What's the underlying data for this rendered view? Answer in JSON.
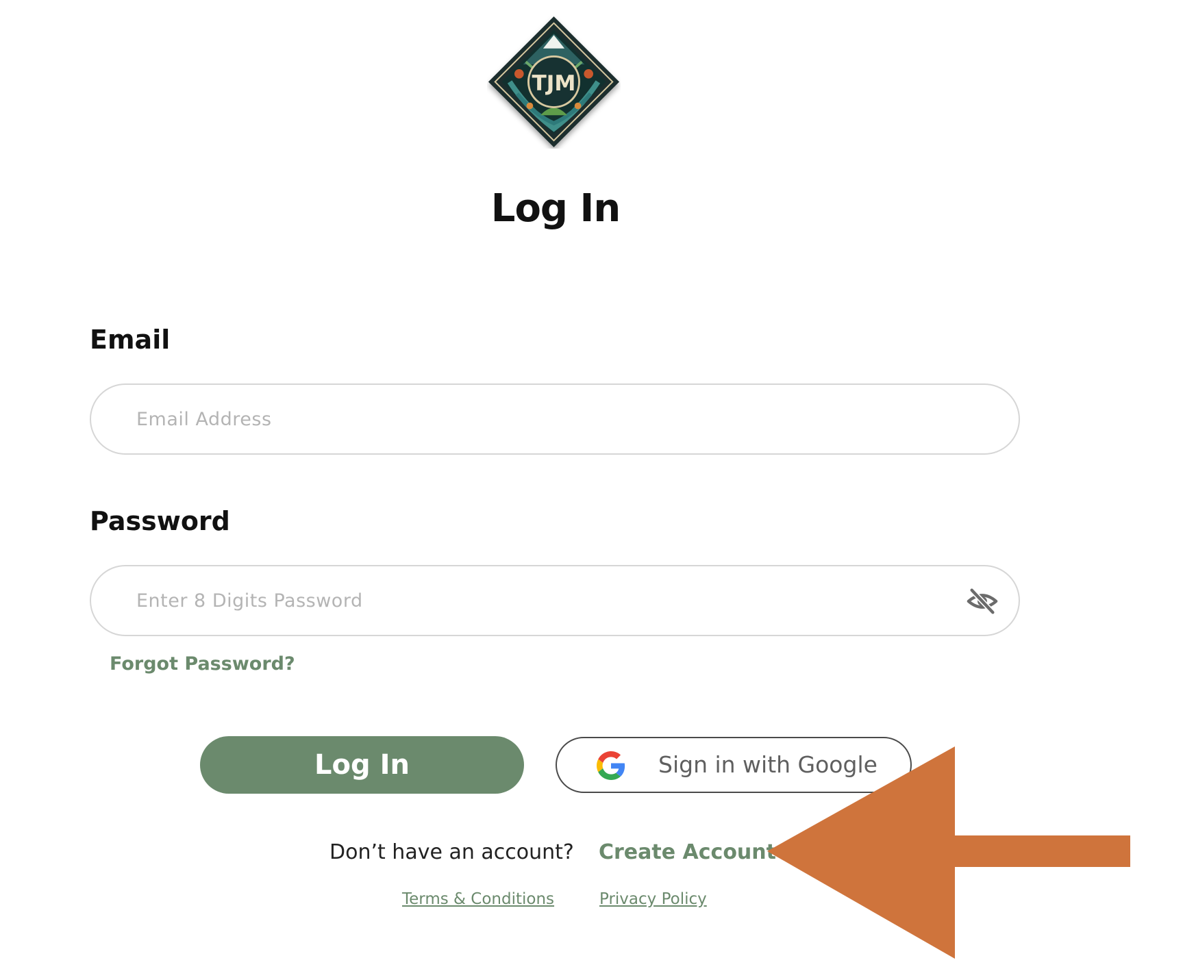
{
  "logo": {
    "text": "TJM",
    "icon": "tjm-diamond-logo"
  },
  "page_title": "Log In",
  "email": {
    "label": "Email",
    "placeholder": "Email Address",
    "value": ""
  },
  "password": {
    "label": "Password",
    "placeholder": "Enter 8 Digits Password",
    "value": "",
    "toggle_icon": "eye-off-icon"
  },
  "forgot_password": "Forgot Password?",
  "buttons": {
    "login": "Log In",
    "google": "Sign in with Google",
    "google_icon": "google-g-icon"
  },
  "signup": {
    "prompt": "Don’t have an account?",
    "link": "Create Account"
  },
  "legal": {
    "terms": "Terms & Conditions",
    "privacy": "Privacy Policy"
  },
  "annotation": {
    "icon": "arrow-left-icon",
    "color": "#cf743c"
  },
  "colors": {
    "accent": "#6b8a6d",
    "text": "#111111",
    "border": "#d6d6d6"
  }
}
